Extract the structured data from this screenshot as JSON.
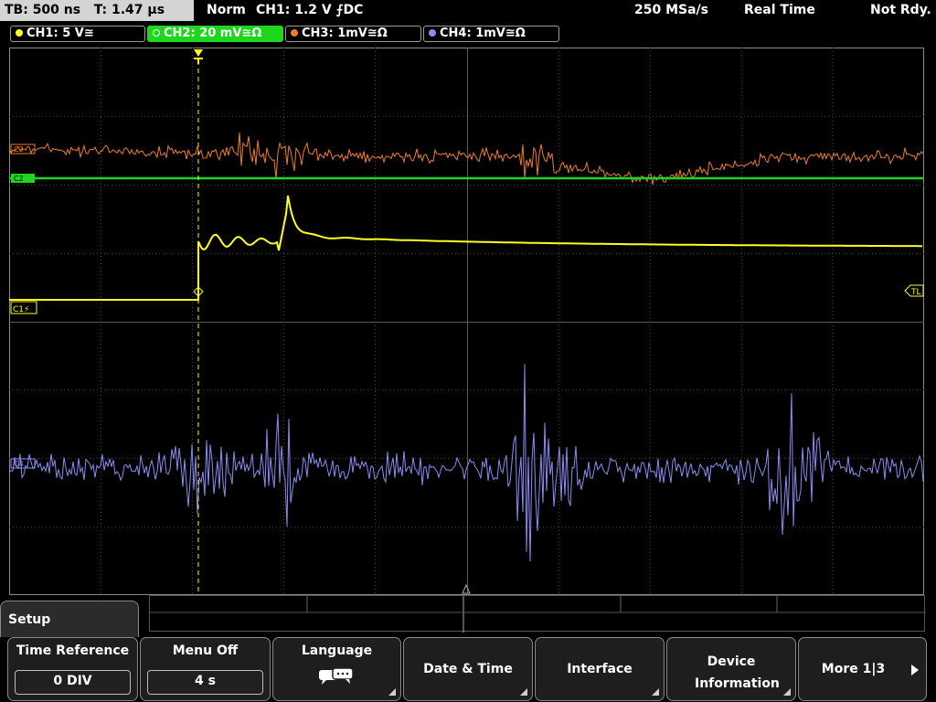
{
  "status": {
    "timebase": "TB: 500 ns",
    "trigger_time": "T: 1.47 µs",
    "mode": "Norm",
    "trigger": "CH1: 1.2 V ⨍DC",
    "sample_rate": "250 MSa/s",
    "acquisition": "Real Time",
    "state": "Not Rdy."
  },
  "channels": [
    {
      "label": "CH1: 5 V≅",
      "color": "#ffff20"
    },
    {
      "label": "CH2: 20 mV≅Ω",
      "color": "#1fd61f"
    },
    {
      "label": "CH3: 1mV≅Ω",
      "color": "#f07d25"
    },
    {
      "label": "CH4: 1mV≅Ω",
      "color": "#8c8cf5"
    }
  ],
  "markers": {
    "ch1_tag": "C1⚡",
    "trigger_level": "TL",
    "ch2_tag": "C2",
    "ch3_tag": "C3",
    "ch4_tag": "C4"
  },
  "menu": {
    "title": "Setup",
    "softkeys": [
      {
        "label": "Time Reference",
        "value": "0 DIV"
      },
      {
        "label": "Menu Off",
        "value": "4 s"
      },
      {
        "label": "Language",
        "icon": "speech-bubble-icon"
      },
      {
        "label": "Date & Time"
      },
      {
        "label": "Interface"
      },
      {
        "label": "Device Information"
      },
      {
        "label": "More 1|3"
      }
    ]
  }
}
